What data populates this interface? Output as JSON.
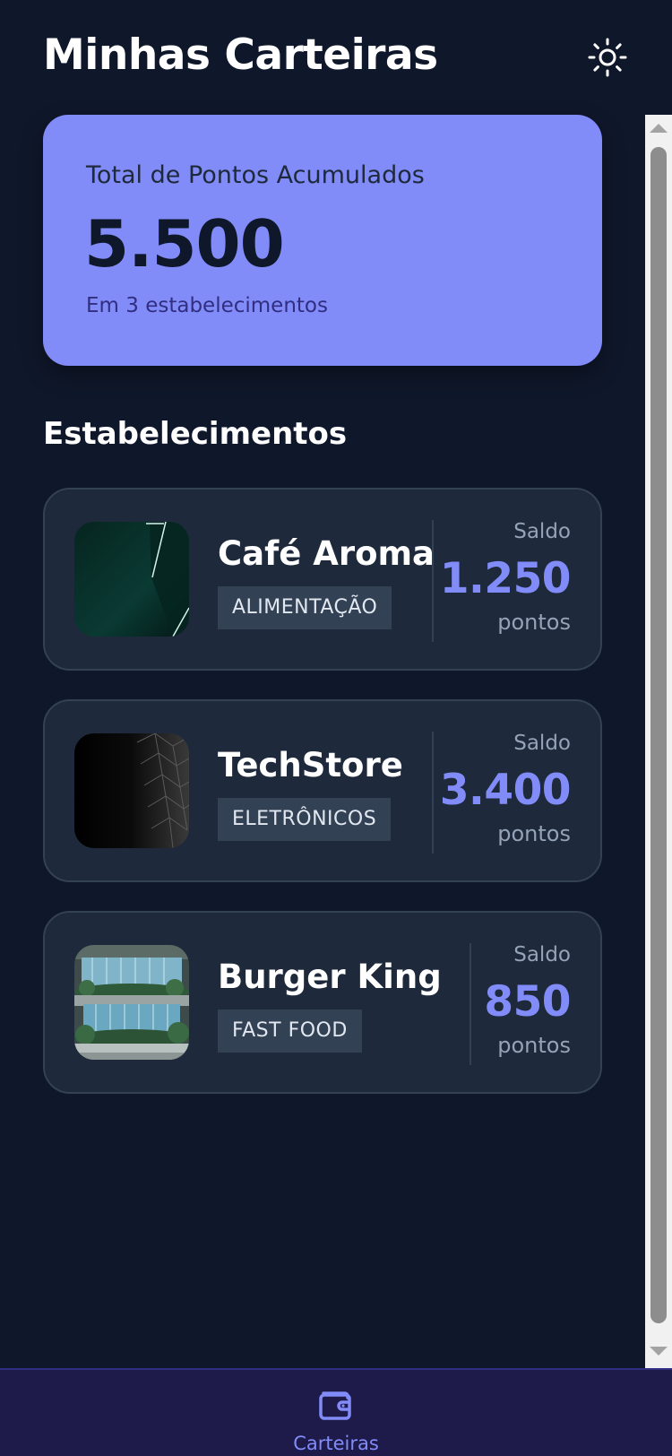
{
  "header": {
    "title": "Minhas Carteiras",
    "theme_icon": "sun-icon"
  },
  "summary": {
    "label": "Total de Pontos Acumulados",
    "total": "5.500",
    "subtitle": "Em 3 estabelecimentos"
  },
  "section": {
    "title": "Estabelecimentos"
  },
  "wallets": [
    {
      "name": "Café Aroma",
      "category": "ALIMENTAÇÃO",
      "balance_label": "Saldo",
      "balance": "1.250",
      "unit": "pontos",
      "thumb": "dark-teal-abstract-photo"
    },
    {
      "name": "TechStore",
      "category": "ELETRÔNICOS",
      "balance_label": "Saldo",
      "balance": "3.400",
      "unit": "pontos",
      "thumb": "black-geometric-facade-photo"
    },
    {
      "name": "Burger King",
      "category": "FAST FOOD",
      "balance_label": "Saldo",
      "balance": "850",
      "unit": "pontos",
      "thumb": "green-building-photo"
    }
  ],
  "bottom_nav": {
    "items": [
      {
        "label": "Carteiras",
        "icon": "wallet-icon",
        "active": true
      }
    ]
  },
  "colors": {
    "background": "#0f172a",
    "card": "#1e293b",
    "accent": "#818cf8",
    "nav_background": "#1e1b4b"
  }
}
